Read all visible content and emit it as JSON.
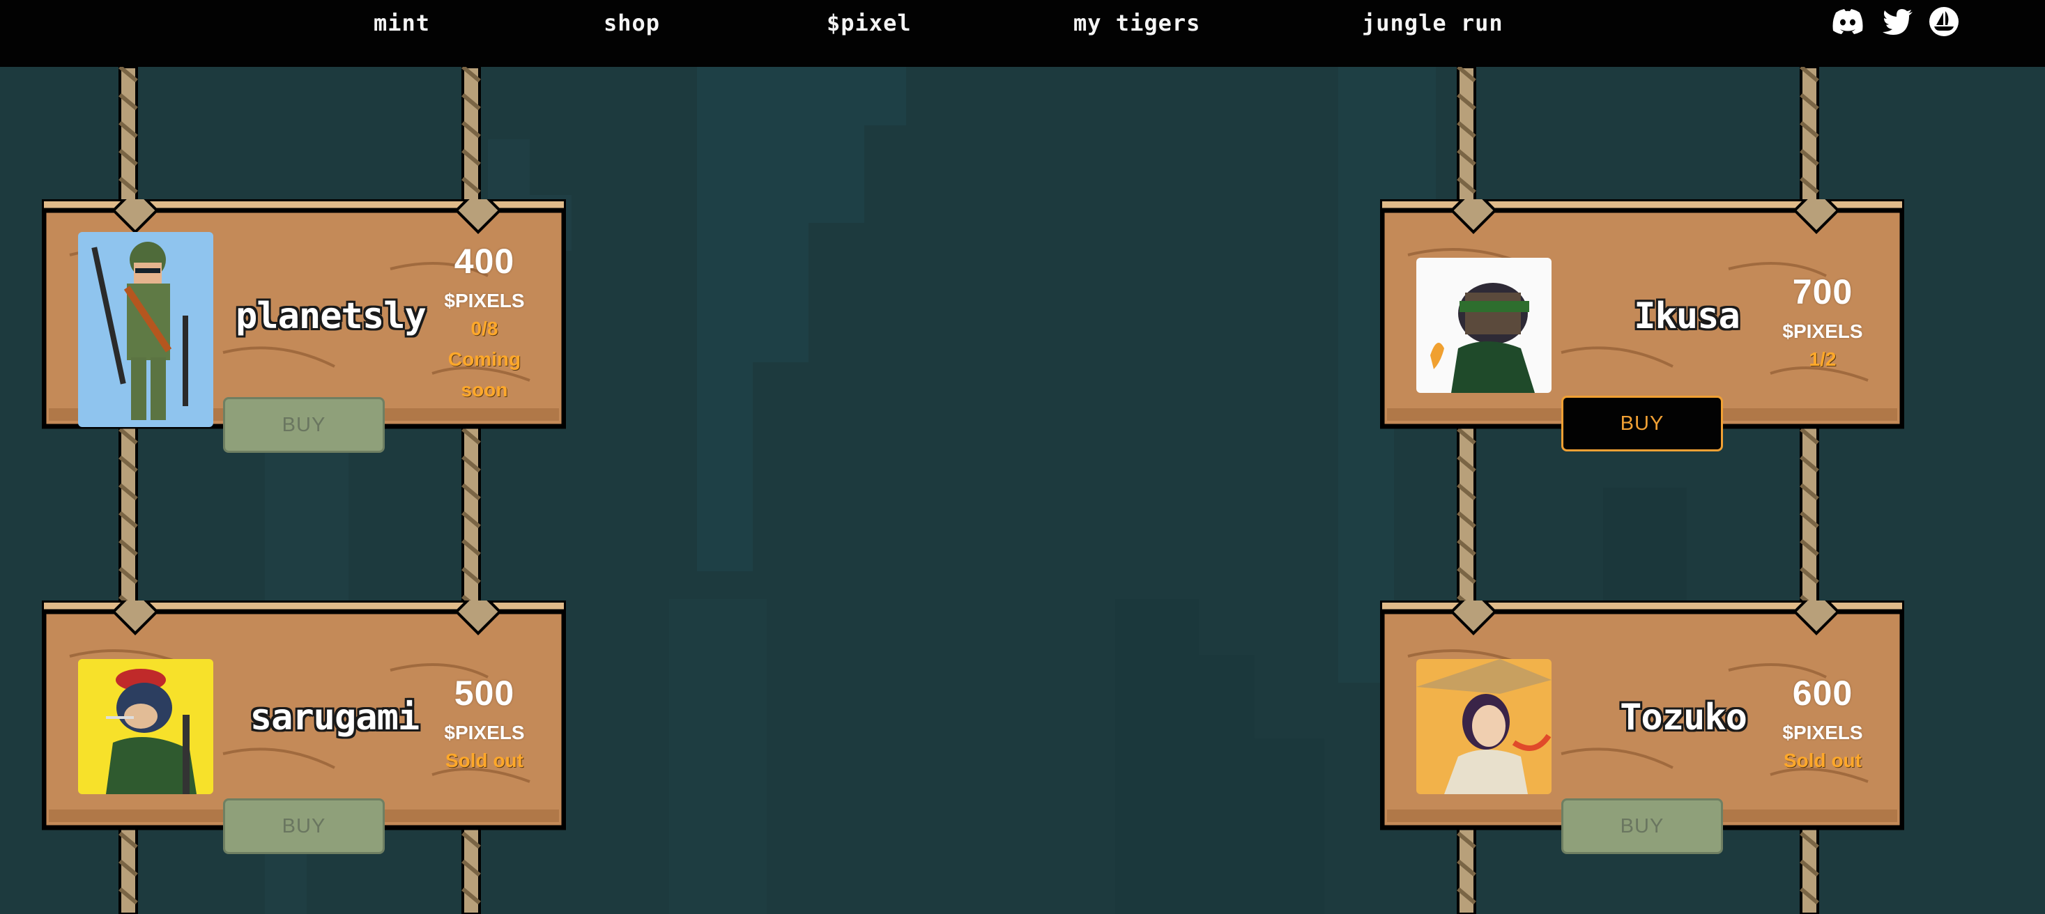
{
  "nav": {
    "items": [
      "mint",
      "shop",
      "$pixel",
      "my tigers",
      "jungle run"
    ],
    "social": [
      "discord-icon",
      "twitter-icon",
      "opensea-icon"
    ]
  },
  "colors": {
    "background": "#1d3a3e",
    "nav": "#020202",
    "wood": "#c48a58",
    "status": "#ffa82a",
    "buy_active_border": "#f0a034",
    "buy_disabled": "#8fa07a"
  },
  "products": [
    {
      "name": "planetsly",
      "price": "400",
      "unit": "$PIXELS",
      "stock": "0/8",
      "status": "Coming soon",
      "buy": "BUY",
      "buy_enabled": false
    },
    {
      "name": "Ikusa",
      "price": "700",
      "unit": "$PIXELS",
      "stock": "1/2",
      "status": "",
      "buy": "BUY",
      "buy_enabled": true
    },
    {
      "name": "sarugami",
      "price": "500",
      "unit": "$PIXELS",
      "stock": "",
      "status": "Sold out",
      "buy": "BUY",
      "buy_enabled": false
    },
    {
      "name": "Tozuko",
      "price": "600",
      "unit": "$PIXELS",
      "stock": "",
      "status": "Sold out",
      "buy": "BUY",
      "buy_enabled": false
    }
  ]
}
